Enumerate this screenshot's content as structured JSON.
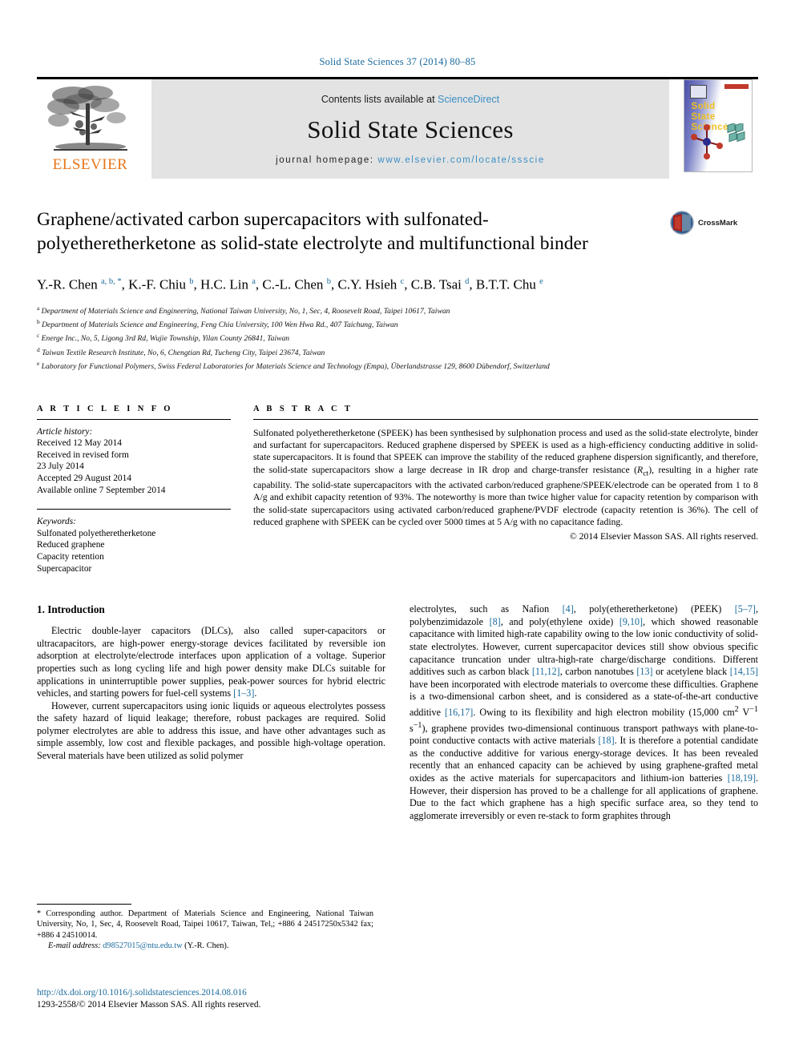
{
  "running_head": "Solid State Sciences 37 (2014) 80–85",
  "masthead": {
    "publisher_name": "ELSEVIER",
    "contents_prefix": "Contents lists available at",
    "contents_link": "ScienceDirect",
    "journal_title": "Solid State Sciences",
    "homepage_label": "journal homepage:",
    "homepage_url": "www.elsevier.com/locate/ssscie",
    "cover_title_lines": [
      "Solid",
      "State",
      "Sciences"
    ],
    "colors": {
      "elsevier_orange": "#e8761a",
      "link_blue": "#3a8fc4",
      "band_gray": "#e3e3e3",
      "cover_yellow": "#f0c020"
    }
  },
  "article": {
    "title": "Graphene/activated carbon supercapacitors with sulfonated-polyetheretherketone as solid-state electrolyte and multifunctional binder",
    "crossmark_label": "CrossMark",
    "authors": [
      {
        "name": "Y.-R. Chen",
        "marks": "a, b, *"
      },
      {
        "name": "K.-F. Chiu",
        "marks": "b"
      },
      {
        "name": "H.C. Lin",
        "marks": "a"
      },
      {
        "name": "C.-L. Chen",
        "marks": "b"
      },
      {
        "name": "C.Y. Hsieh",
        "marks": "c"
      },
      {
        "name": "C.B. Tsai",
        "marks": "d"
      },
      {
        "name": "B.T.T. Chu",
        "marks": "e"
      }
    ],
    "affiliations": [
      {
        "mark": "a",
        "text": "Department of Materials Science and Engineering, National Taiwan University, No, 1, Sec, 4, Roosevelt Road, Taipei 10617, Taiwan"
      },
      {
        "mark": "b",
        "text": "Department of Materials Science and Engineering, Feng Chia University, 100 Wen Hwa Rd., 407 Taichung, Taiwan"
      },
      {
        "mark": "c",
        "text": "Energe Inc., No, 5, Ligong 3rd Rd, Wujie Township, Yilan County 26841, Taiwan"
      },
      {
        "mark": "d",
        "text": "Taiwan Textile Research Institute, No, 6, Chengtian Rd, Tucheng City, Taipei 23674, Taiwan"
      },
      {
        "mark": "e",
        "text": "Laboratory for Functional Polymers, Swiss Federal Laboratories for Materials Science and Technology (Empa), Überlandstrasse 129, 8600 Dübendorf, Switzerland"
      }
    ]
  },
  "article_info": {
    "heading": "A R T I C L E  I N F O",
    "history_label": "Article history:",
    "history": [
      "Received 12 May 2014",
      "Received in revised form",
      "23 July 2014",
      "Accepted 29 August 2014",
      "Available online 7 September 2014"
    ],
    "keywords_label": "Keywords:",
    "keywords": [
      "Sulfonated polyetheretherketone",
      "Reduced graphene",
      "Capacity retention",
      "Supercapacitor"
    ]
  },
  "abstract": {
    "heading": "A B S T R A C T",
    "text_part1": "Sulfonated polyetheretherketone (SPEEK) has been synthesised by sulphonation process and used as the solid-state electrolyte, binder and surfactant for supercapacitors. Reduced graphene dispersed by SPEEK is used as a high-efficiency conducting additive in solid-state supercapacitors. It is found that SPEEK can improve the stability of the reduced graphene dispersion significantly, and therefore, the solid-state supercapacitors show a large decrease in IR drop and charge-transfer resistance (",
    "rct_symbol": "R",
    "rct_subscript": "ct",
    "text_part2": "), resulting in a higher rate capability. The solid-state supercapacitors with the activated carbon/reduced graphene/SPEEK/electrode can be operated from 1 to 8 A/g and exhibit capacity retention of 93%. The noteworthy is more than twice higher value for capacity retention by comparison with the solid-state supercapacitors using activated carbon/reduced graphene/PVDF electrode (capacity retention is 36%). The cell of reduced graphene with SPEEK can be cycled over 5000 times at 5 A/g with no capacitance fading.",
    "copyright": "© 2014 Elsevier Masson SAS. All rights reserved."
  },
  "body": {
    "section_title": "1. Introduction",
    "left_paragraph_1_a": "Electric double-layer capacitors (DLCs), also called super-capacitors or ultracapacitors, are high-power energy-storage devices facilitated by reversible ion adsorption at electrolyte/electrode interfaces upon application of a voltage. Superior properties such as long cycling life and high power density make DLCs suitable for applications in uninterruptible power supplies, peak-power sources for hybrid electric vehicles, and starting powers for fuel-cell systems ",
    "left_paragraph_1_cite": "[1–3]",
    "left_paragraph_1_b": ".",
    "left_paragraph_2": "However, current supercapacitors using ionic liquids or aqueous electrolytes possess the safety hazard of liquid leakage; therefore, robust packages are required. Solid polymer electrolytes are able to address this issue, and have other advantages such as simple assembly, low cost and flexible packages, and possible high-voltage operation. Several materials have been utilized as solid polymer",
    "right_segments": [
      {
        "t": "electrolytes, such as Nafion "
      },
      {
        "c": "[4]"
      },
      {
        "t": ", poly(etheretherketone) (PEEK) "
      },
      {
        "c": "[5–7]"
      },
      {
        "t": ", polybenzimidazole "
      },
      {
        "c": "[8]"
      },
      {
        "t": ", and poly(ethylene oxide) "
      },
      {
        "c": "[9,10]"
      },
      {
        "t": ", which showed reasonable capacitance with limited high-rate capability owing to the low ionic conductivity of solid-state electrolytes. However, current supercapacitor devices still show obvious specific capacitance truncation under ultra-high-rate charge/discharge conditions. Different additives such as carbon black "
      },
      {
        "c": "[11,12]"
      },
      {
        "t": ", carbon nanotubes "
      },
      {
        "c": "[13]"
      },
      {
        "t": " or acetylene black "
      },
      {
        "c": "[14,15]"
      },
      {
        "t": " have been incorporated with electrode materials to overcome these difficulties. Graphene is a two-dimensional carbon sheet, and is considered as a state-of-the-art conductive additive "
      },
      {
        "c": "[16,17]"
      },
      {
        "t": ". Owing to its flexibility and high electron mobility (15,000 cm"
      },
      {
        "sup": "2"
      },
      {
        "t": " V"
      },
      {
        "sup": "−1"
      },
      {
        "t": " s"
      },
      {
        "sup": "−1"
      },
      {
        "t": "), graphene provides two-dimensional continuous transport pathways with plane-to-point conductive contacts with active materials "
      },
      {
        "c": "[18]"
      },
      {
        "t": ". It is therefore a potential candidate as the conductive additive for various energy-storage devices. It has been revealed recently that an enhanced capacity can be achieved by using graphene-grafted metal oxides as the active materials for supercapacitors and lithium-ion batteries "
      },
      {
        "c": "[18,19]"
      },
      {
        "t": ". However, their dispersion has proved to be a challenge for all applications of graphene. Due to the fact which graphene has a high specific surface area, so they tend to agglomerate irreversibly or even re-stack to form graphites through"
      }
    ]
  },
  "footnote": {
    "star": "*",
    "text": " Corresponding author. Department of Materials Science and Engineering, National Taiwan University, No, 1, Sec, 4, Roosevelt Road, Taipei 10617, Taiwan, Tel,; +886 4 24517250x5342 fax; +886 4 24510014.",
    "email_label": "E-mail address:",
    "email": "d98527015@ntu.edu.tw",
    "email_owner": "(Y.-R. Chen)."
  },
  "doi_block": {
    "doi_url": "http://dx.doi.org/10.1016/j.solidstatesciences.2014.08.016",
    "issn_line": "1293-2558/© 2014 Elsevier Masson SAS. All rights reserved."
  }
}
